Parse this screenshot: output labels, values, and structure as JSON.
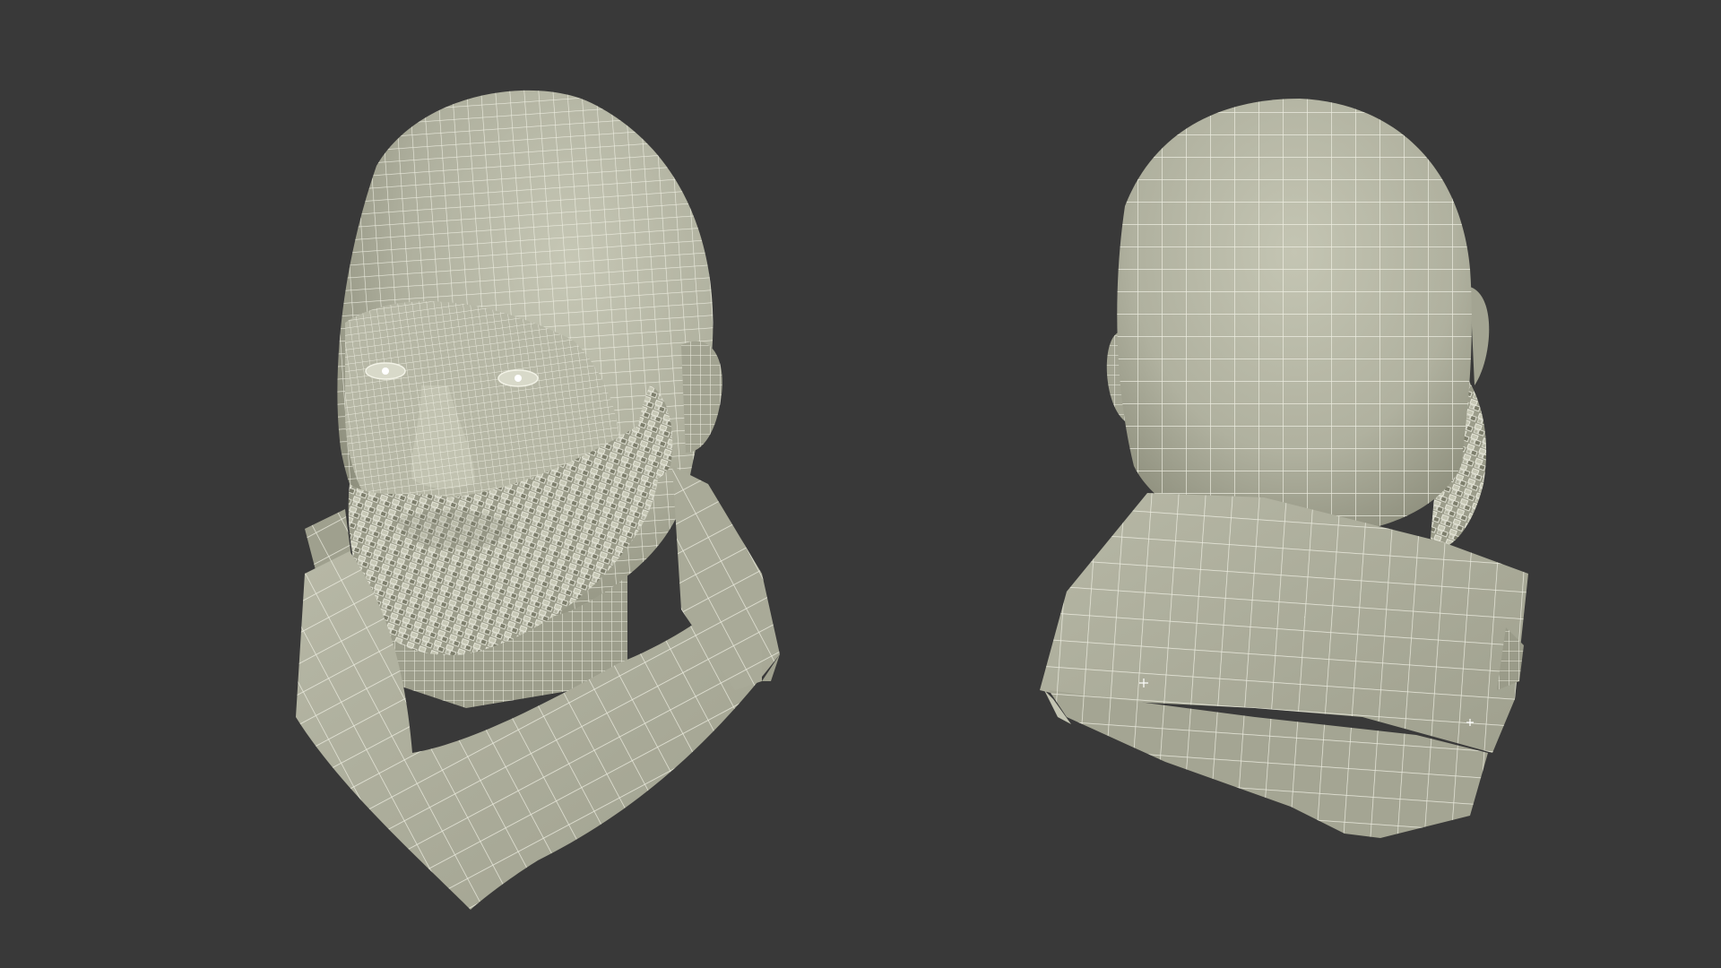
{
  "viewport": {
    "background": "#393939"
  },
  "material": {
    "fill": "#aeaf9d",
    "fill_shadow": "#8d8e7c",
    "fill_highlight": "#c3c4b2",
    "wire": "#f2f2e6"
  },
  "models": [
    {
      "name": "head-front-three-quarter-view"
    },
    {
      "name": "head-back-view"
    }
  ]
}
